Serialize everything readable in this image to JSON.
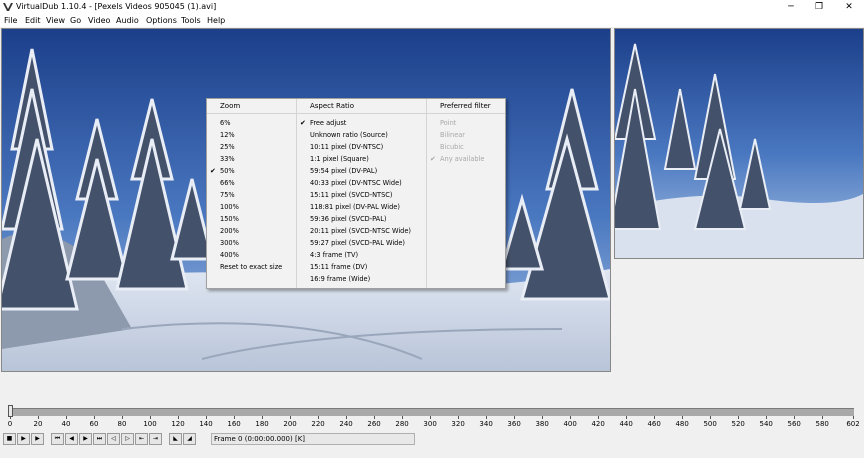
{
  "window": {
    "title": "VirtualDub 1.10.4 - [Pexels Videos 905045 (1).avi]",
    "minimize": "─",
    "maximize": "❐",
    "close": "✕"
  },
  "menubar": [
    "File",
    "Edit",
    "View",
    "Go",
    "Video",
    "Audio",
    "Options",
    "Tools",
    "Help"
  ],
  "context_menu": {
    "zoom": {
      "header": "Zoom",
      "items": [
        "6%",
        "12%",
        "25%",
        "33%",
        "50%",
        "66%",
        "75%",
        "100%",
        "150%",
        "200%",
        "300%",
        "400%",
        "Reset to exact size"
      ],
      "checked": "50%"
    },
    "aspect_ratio": {
      "header": "Aspect Ratio",
      "items": [
        "Free adjust",
        "Unknown ratio (Source)",
        "10:11 pixel (DV-NTSC)",
        "1:1 pixel (Square)",
        "59:54 pixel (DV-PAL)",
        "40:33 pixel (DV-NTSC Wide)",
        "15:11 pixel (SVCD-NTSC)",
        "118:81 pixel (DV-PAL Wide)",
        "59:36 pixel (SVCD-PAL)",
        "20:11 pixel (SVCD-NTSC Wide)",
        "59:27 pixel (SVCD-PAL Wide)",
        "4:3 frame (TV)",
        "15:11 frame (DV)",
        "16:9 frame (Wide)"
      ],
      "checked": "Free adjust"
    },
    "preferred_filter": {
      "header": "Preferred filter",
      "items": [
        "Point",
        "Bilinear",
        "Bicubic",
        "Any available"
      ],
      "checked": "Any available",
      "disabled": true
    }
  },
  "timeline": {
    "min": 0,
    "max": 602,
    "position": 0,
    "tick_labels": [
      "0",
      "20",
      "40",
      "60",
      "80",
      "100",
      "120",
      "140",
      "160",
      "180",
      "200",
      "220",
      "240",
      "260",
      "280",
      "300",
      "320",
      "340",
      "360",
      "380",
      "400",
      "420",
      "440",
      "460",
      "480",
      "500",
      "520",
      "540",
      "560",
      "580",
      "602"
    ]
  },
  "status": {
    "frame_text": "Frame 0 (0:00:00.000) [K]"
  },
  "colors": {
    "window_bg": "#f0f0f0",
    "menu_bg": "#f2f2f2",
    "disabled_text": "#a8a8a8",
    "timeline": "#a9a9a9"
  }
}
